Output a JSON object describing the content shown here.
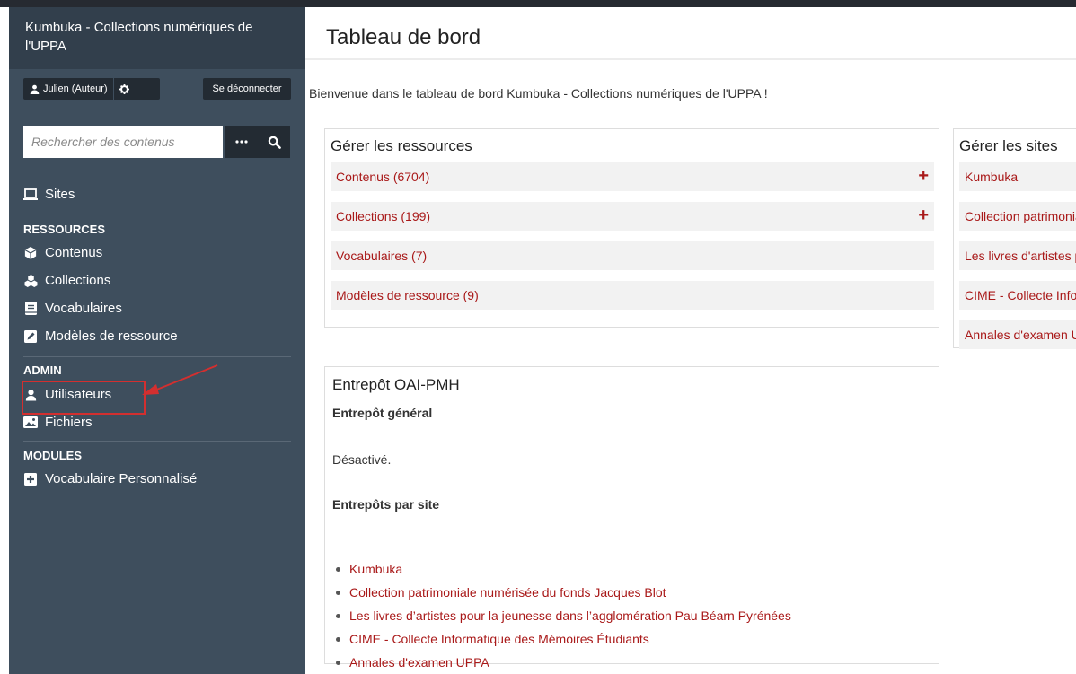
{
  "sidebar": {
    "site_name": "Kumbuka - Collections numériques de l'UPPA",
    "user_label": "Julien (Auteur)",
    "logout_label": "Se déconnecter",
    "search": {
      "placeholder": "Rechercher des contenus",
      "value": ""
    },
    "sites_label": "Sites",
    "resources_heading": "RESSOURCES",
    "resources": [
      "Contenus",
      "Collections",
      "Vocabulaires",
      "Modèles de ressource"
    ],
    "admin_heading": "ADMIN",
    "admin": [
      "Utilisateurs",
      "Fichiers"
    ],
    "modules_heading": "MODULES",
    "modules": [
      "Vocabulaire Personnalisé"
    ]
  },
  "main": {
    "title": "Tableau de bord",
    "welcome": "Bienvenue dans le tableau de bord Kumbuka - Collections numériques de l'UPPA !",
    "resources_panel": {
      "title": "Gérer les ressources",
      "rows": [
        "Contenus (6704)",
        "Collections (199)",
        "Vocabulaires (7)",
        "Modèles de ressource (9)"
      ]
    },
    "sites_panel": {
      "title": "Gérer les sites",
      "rows": [
        "Kumbuka",
        "Collection patrimoniale numérisée du fonds Jacques Blot",
        "Les livres d'artistes pour la jeunesse dans l'agglomération Pau Béarn Pyrénées",
        "CIME - Collecte Informatique des Mémoires Étudiants",
        "Annales d'examen UPPA"
      ]
    },
    "oai_panel": {
      "title": "Entrepôt OAI-PMH",
      "general_heading": "Entrepôt général",
      "general_status": "Désactivé.",
      "per_site_heading": "Entrepôts par site",
      "sites": [
        "Kumbuka",
        "Collection patrimoniale numérisée du fonds Jacques Blot",
        "Les livres d’artistes pour la jeunesse dans l’agglomération Pau Béarn Pyrénées",
        "CIME - Collecte Informatique des Mémoires Étudiants",
        "Annales d'examen UPPA"
      ]
    }
  },
  "colors": {
    "sidebar": "#3e4e5d",
    "sidebar_head": "#323f4c",
    "link": "#a91919",
    "annotation": "#d32f2f"
  }
}
